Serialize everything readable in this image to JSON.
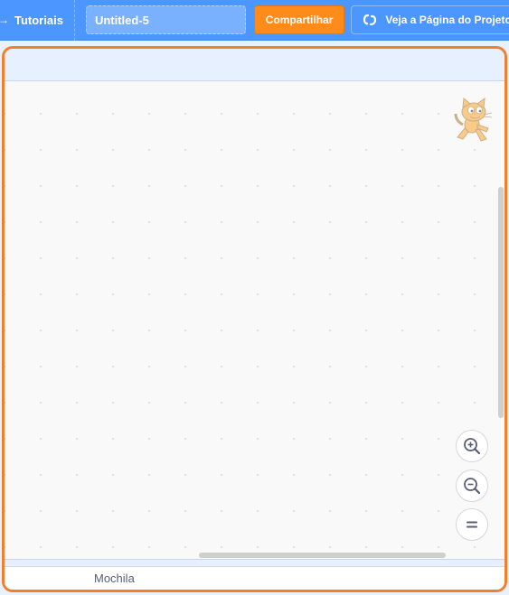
{
  "menubar": {
    "tutorials_label": "Tutoriais",
    "project_title_value": "Untitled-5",
    "share_label": "Compartilhar",
    "see_project_page_label": "Veja a Página do Projeto"
  },
  "workspace": {
    "sprite_icon": "scratch-cat-sprite",
    "zoom_in_icon": "zoom-in-icon",
    "zoom_out_icon": "zoom-out-icon",
    "zoom_reset_icon": "zoom-reset-icon"
  },
  "backpack": {
    "label": "Mochila"
  },
  "colors": {
    "menubar": "#4c97ff",
    "share_button": "#ff8c1a",
    "focus_outline": "#f07f2e",
    "workspace_bg": "#f9f9f9",
    "text_gray": "#575e75"
  }
}
